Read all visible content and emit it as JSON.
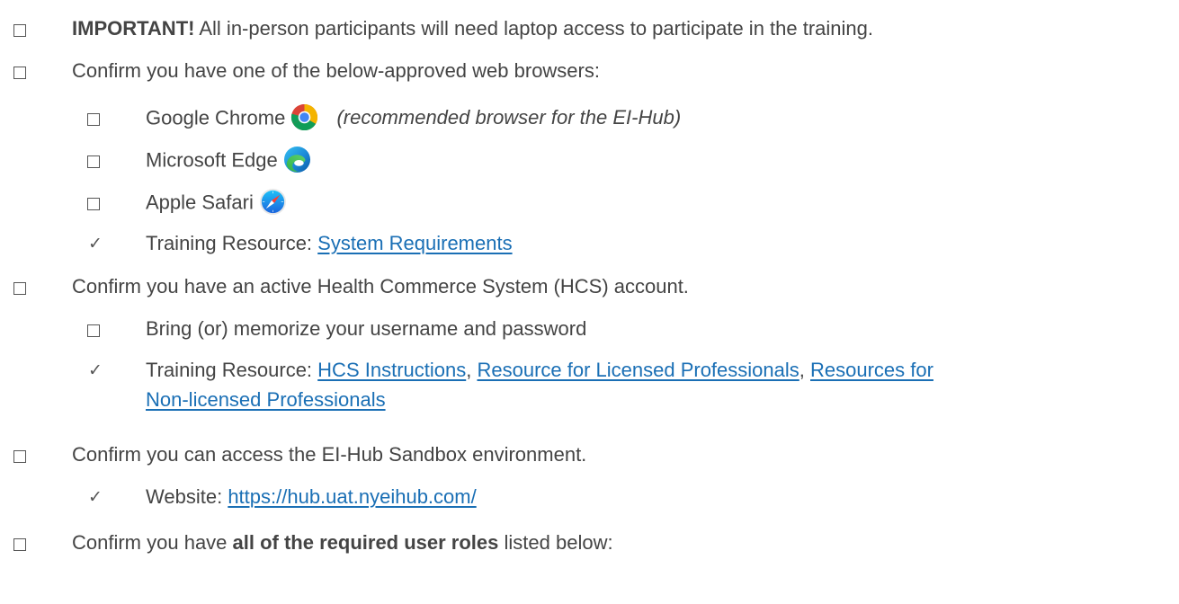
{
  "items": {
    "important": {
      "bold": "IMPORTANT!",
      "text": " All in-person participants will need laptop access to participate in the training."
    },
    "browsers": {
      "text": "Confirm you have one of the below-approved web browsers:",
      "chrome": {
        "label": "Google Chrome",
        "note": "(recommended browser for the EI-Hub)",
        "icon": "chrome-icon"
      },
      "edge": {
        "label": "Microsoft Edge",
        "icon": "edge-icon"
      },
      "safari": {
        "label": "Apple Safari",
        "icon": "safari-icon"
      },
      "resource": {
        "prefix": "Training Resource: ",
        "link": "System Requirements"
      }
    },
    "hcs": {
      "text": "Confirm you have an active Health Commerce System (HCS) account.",
      "bring": "Bring (or) memorize your username and password",
      "resource": {
        "prefix": "Training Resource: ",
        "link1": "HCS Instructions",
        "sep1": ", ",
        "link2": "Resource for Licensed Professionals",
        "sep2": ", ",
        "link3a": "Resources for",
        "link3b": "Non-licensed Professionals"
      }
    },
    "sandbox": {
      "text": "Confirm you can access the EI-Hub Sandbox environment.",
      "website": {
        "prefix": "Website: ",
        "link": "https://hub.uat.nyeihub.com/"
      }
    },
    "roles": {
      "pre": "Confirm you have ",
      "bold": "all of the required user roles",
      "post": " listed below:"
    }
  },
  "colors": {
    "text": "#444444",
    "link": "#1a6fb5"
  }
}
